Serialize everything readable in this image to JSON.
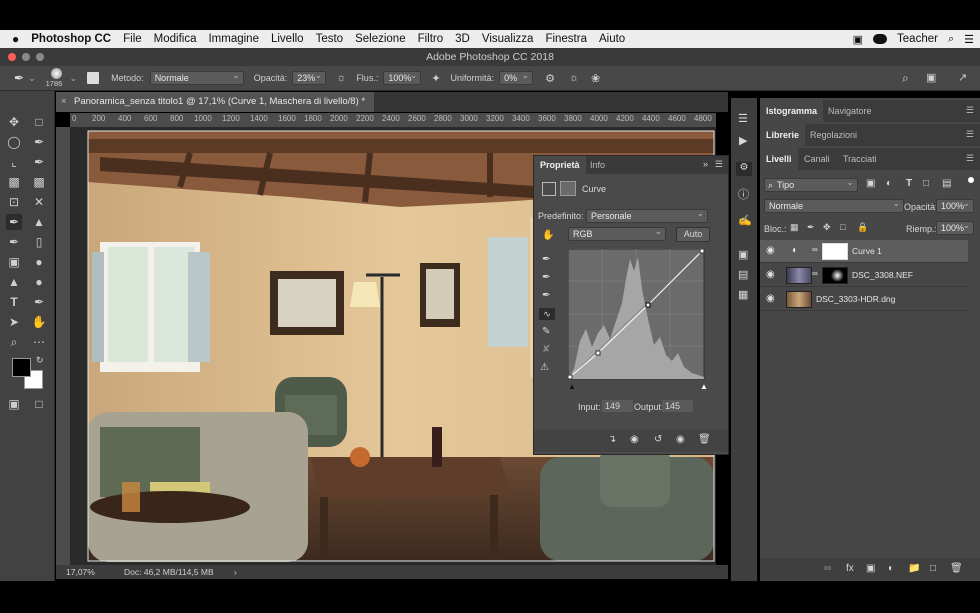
{
  "menubar": {
    "apple": "",
    "app": "Photoshop CC",
    "items": [
      "File",
      "Modifica",
      "Immagine",
      "Livello",
      "Testo",
      "Selezione",
      "Filtro",
      "3D",
      "Visualizza",
      "Finestra",
      "Aiuto"
    ],
    "user": "Teacher"
  },
  "window": {
    "title": "Adobe Photoshop CC 2018"
  },
  "options": {
    "brush_size": "1786",
    "metodo_label": "Metodo:",
    "metodo_value": "Normale",
    "opacita_label": "Opacità:",
    "opacita_value": "23%",
    "flusso_label": "Flus.:",
    "flusso_value": "100%",
    "uniformita_label": "Uniformità:",
    "uniformita_value": "0%"
  },
  "document": {
    "tab_title": "Panoramica_senza titolo1 @ 17,1% (Curve 1, Maschera di livello/8) *",
    "ruler_ticks": [
      "0",
      "200",
      "400",
      "600",
      "800",
      "1000",
      "1200",
      "1400",
      "1600",
      "1800",
      "2000",
      "2200",
      "2400",
      "2600",
      "2800",
      "3000",
      "3200",
      "3400",
      "3600",
      "3800",
      "4000",
      "4200",
      "4400",
      "4600",
      "4800"
    ],
    "zoom": "17,07%",
    "doc_info": "Doc: 46,2 MB/114,5 MB"
  },
  "properties": {
    "tabs": [
      "Proprietà",
      "Info"
    ],
    "type_label": "Curve",
    "preset_label": "Predefinito:",
    "preset_value": "Personale",
    "channel_value": "RGB",
    "auto_label": "Auto",
    "input_label": "Input:",
    "input_value": "149",
    "output_label": "Output:",
    "output_value": "145"
  },
  "panels": {
    "top_tabs": [
      "Istogramma",
      "Navigatore"
    ],
    "mid_tabs": [
      "Librerie",
      "Regolazioni"
    ],
    "layer_tabs": [
      "Livelli",
      "Canali",
      "Tracciati"
    ],
    "filter_value": "Tipo",
    "blend_value": "Normale",
    "opacity_label": "Opacità:",
    "opacity_value": "100%",
    "lock_label": "Bloc.:",
    "fill_label": "Riemp.:",
    "fill_value": "100%",
    "layers": [
      {
        "name": "Curve 1"
      },
      {
        "name": "DSC_3308.NEF"
      },
      {
        "name": "DSC_3303-HDR.dng"
      }
    ]
  },
  "colors": {
    "accent": "#f5f5f5",
    "panel": "#474747",
    "toolbar": "#424242"
  }
}
